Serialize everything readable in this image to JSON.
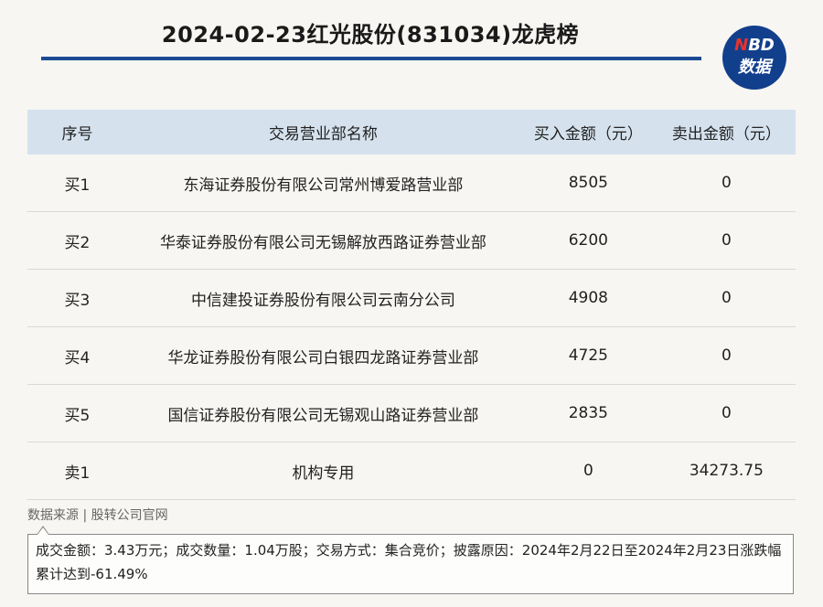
{
  "title": "2024-02-23红光股份(831034)龙虎榜",
  "logo": {
    "line1_n": "N",
    "line1_rest": "BD",
    "line2": "数据"
  },
  "table": {
    "headers": [
      "序号",
      "交易营业部名称",
      "买入金额（元）",
      "卖出金额（元）"
    ],
    "rows": [
      [
        "买1",
        "东海证券股份有限公司常州博爱路营业部",
        "8505",
        "0"
      ],
      [
        "买2",
        "华泰证券股份有限公司无锡解放西路证券营业部",
        "6200",
        "0"
      ],
      [
        "买3",
        "中信建投证券股份有限公司云南分公司",
        "4908",
        "0"
      ],
      [
        "买4",
        "华龙证券股份有限公司白银四龙路证券营业部",
        "4725",
        "0"
      ],
      [
        "买5",
        "国信证券股份有限公司无锡观山路证券营业部",
        "2835",
        "0"
      ],
      [
        "卖1",
        "机构专用",
        "0",
        "34273.75"
      ]
    ]
  },
  "source": "数据来源 | 股转公司官网",
  "note": "成交金额：3.43万元；成交数量：1.04万股；交易方式：集合竞价；披露原因：2024年2月22日至2024年2月23日涨跌幅累计达到-61.49%"
}
